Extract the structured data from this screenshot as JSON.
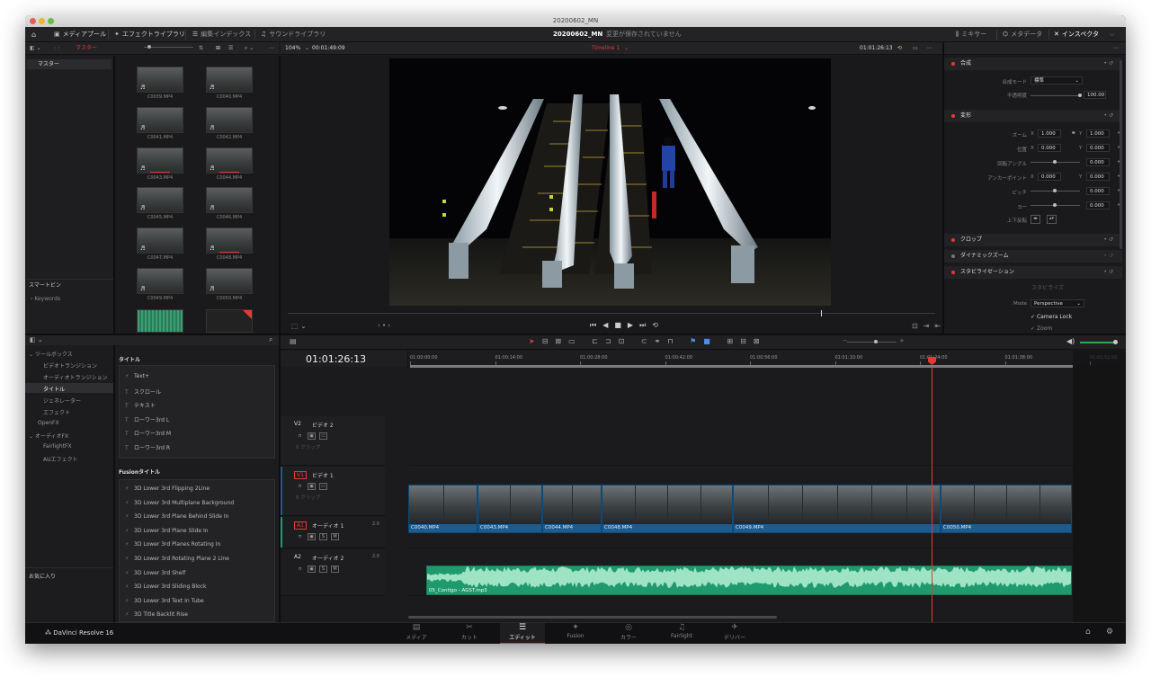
{
  "window": {
    "title": "20200602_MN"
  },
  "topbar": {
    "media_pool": "メディアプール",
    "effects_library": "エフェクトライブラリ",
    "edit_index": "編集インデックス",
    "sound_library": "サウンドライブラリ",
    "project_name": "20200602_MN",
    "save_status": "変更が保存されていません",
    "mixer": "ミキサー",
    "metadata": "メタデータ",
    "inspector": "インスペクタ"
  },
  "viewer_bar": {
    "bin_label": "マスター",
    "zoom": "104%",
    "source_tc": "00:01:49:09",
    "timeline_name": "Timeline 1",
    "record_tc": "01:01:26:13"
  },
  "bins": {
    "master": "マスター",
    "smart_bins": "スマートビン",
    "keywords": "Keywords",
    "favorites": "お気に入り",
    "clips": [
      "C0039.MP4",
      "C0040.MP4",
      "C0041.MP4",
      "C0042.MP4",
      "C0043.MP4",
      "C0044.MP4",
      "C0045.MP4",
      "C0046.MP4",
      "C0047.MP4",
      "C0048.MP4",
      "C0049.MP4",
      "C0050.MP4"
    ]
  },
  "fx": {
    "toolbox": "ツールボックス",
    "video_transition": "ビデオトランジション",
    "audio_transition": "オーディオトランジション",
    "titles": "タイトル",
    "generators": "ジェネレーター",
    "effects": "エフェクト",
    "openfx": "OpenFX",
    "audiofx": "オーディオFX",
    "fairlightfx": "FairlightFX",
    "au_effects": "AUエフェクト",
    "titles_header": "タイトル",
    "title_items": [
      "Text+",
      "スクロール",
      "テキスト",
      "ローワー3rd L",
      "ローワー3rd M",
      "ローワー3rd R"
    ],
    "fusion_header": "Fusionタイトル",
    "fusion_items": [
      "3D Lower 3rd Flipping 2Line",
      "3D Lower 3rd Multiplane Background",
      "3D Lower 3rd Plane Behind Slide In",
      "3D Lower 3rd Plane Slide In",
      "3D Lower 3rd Planes Rotating In",
      "3D Lower 3rd Rotating Plane 2 Line",
      "3D Lower 3rd Shelf",
      "3D Lower 3rd Sliding Block",
      "3D Lower 3rd Text In Tube",
      "3D Title Backlit Rise"
    ]
  },
  "inspector": {
    "composite": "合成",
    "composite_mode_label": "合成モード",
    "composite_mode_value": "標準",
    "opacity_label": "不透明度",
    "opacity_value": "100.00",
    "transform": "変形",
    "zoom_label": "ズーム",
    "zoom_x": "1.000",
    "zoom_y": "1.000",
    "position_label": "位置",
    "position_x": "0.000",
    "position_y": "0.000",
    "rotation_label": "回転アングル",
    "rotation_value": "0.000",
    "anchor_label": "アンカーポイント",
    "anchor_x": "0.000",
    "anchor_y": "0.000",
    "pitch_label": "ピッチ",
    "pitch_value": "0.000",
    "yaw_label": "ヨー",
    "yaw_value": "0.000",
    "flip_label": "上下反転",
    "crop": "クロップ",
    "dynamic_zoom": "ダイナミックズーム",
    "stabilization": "スタビライゼーション",
    "stabilize_btn": "スタビライズ",
    "mode_label": "Mode",
    "mode_value": "Perspective",
    "camera_lock": "Camera Lock",
    "zoom_check": "Zoom",
    "x": "X",
    "y": "Y"
  },
  "timeline": {
    "timecode": "01:01:26:13",
    "ruler": [
      "01:00:00:00",
      "01:00:14:00",
      "01:00:28:00",
      "01:00:42:00",
      "01:00:56:00",
      "01:01:10:00",
      "01:01:24:00",
      "01:01:38:00",
      "01:01:52:00"
    ],
    "tracks": [
      {
        "id": "V2",
        "name": "ビデオ 2",
        "info": "0 クリップ"
      },
      {
        "id": "V1",
        "name": "ビデオ 1",
        "info": "6 クリップ"
      },
      {
        "id": "A1",
        "name": "オーディオ 1",
        "chan": "2.0"
      },
      {
        "id": "A2",
        "name": "オーディオ 2",
        "chan": "2.0"
      }
    ],
    "video_clips": [
      "C0040.MP4",
      "C0043.MP4",
      "C0044.MP4",
      "C0048.MP4",
      "C0049.MP4",
      "C0050.MP4"
    ],
    "audio_clip": "05_Contigo - AGST.mp3"
  },
  "pages": [
    "メディア",
    "カット",
    "エディット",
    "Fusion",
    "カラー",
    "Fairlight",
    "デリバー"
  ],
  "app_name": "DaVinci Resolve 16",
  "colors": {
    "accent": "#e53935",
    "clip_blue": "#1d5b8f",
    "audio_green": "#1f9a6e"
  }
}
